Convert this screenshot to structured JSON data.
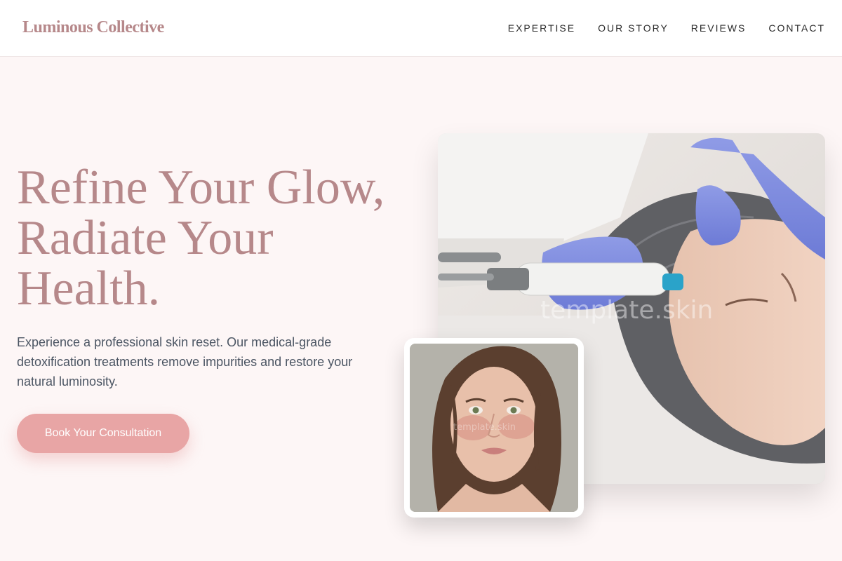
{
  "brand": {
    "name": "Luminous Collective"
  },
  "nav": {
    "items": [
      {
        "label": "EXPERTISE"
      },
      {
        "label": "OUR STORY"
      },
      {
        "label": "REVIEWS"
      },
      {
        "label": "CONTACT"
      }
    ]
  },
  "hero": {
    "headline_line1": "Refine Your Glow,",
    "headline_line2": "Radiate Your",
    "headline_line3": "Health.",
    "description": "Experience a professional skin reset. Our medical-grade detoxification treatments remove impurities and restore your natural luminosity.",
    "cta_label": "Book Your Consultation"
  },
  "images": {
    "main_watermark": "template.skin",
    "inset_watermark": "template.skin"
  },
  "colors": {
    "accent": "#b6888a",
    "button": "#e8a5a5",
    "background": "#fdf6f6"
  }
}
